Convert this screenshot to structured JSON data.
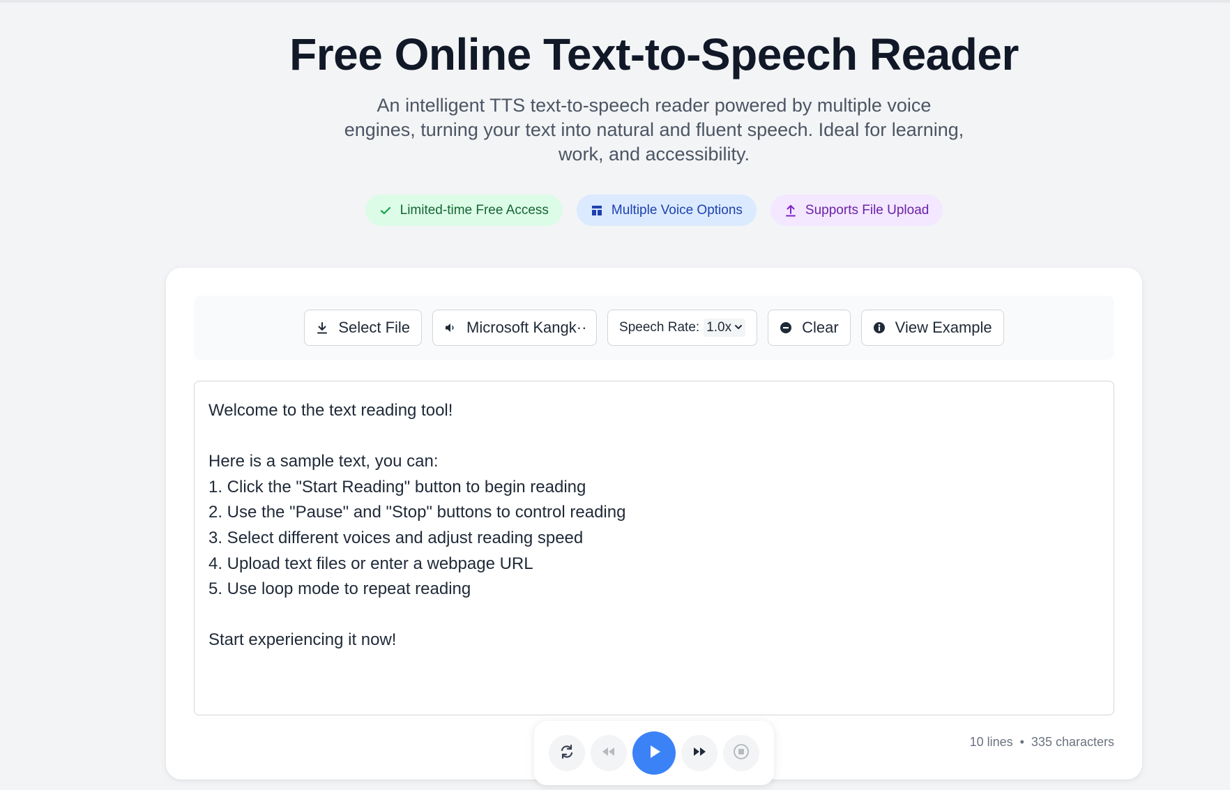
{
  "hero": {
    "title": "Free Online Text-to-Speech Reader",
    "subtitle": "An intelligent TTS text-to-speech reader powered by multiple voice engines, turning your text into natural and fluent speech. Ideal for learning, work, and accessibility."
  },
  "badges": [
    {
      "label": "Limited-time Free Access",
      "icon": "check-icon",
      "color": "#166534"
    },
    {
      "label": "Multiple Voice Options",
      "icon": "layout-icon",
      "color": "#1e40af"
    },
    {
      "label": "Supports File Upload",
      "icon": "upload-icon",
      "color": "#6b21a8"
    }
  ],
  "toolbar": {
    "select_file": "Select File",
    "voice": "Microsoft Kangk···",
    "rate_label": "Speech Rate:",
    "rate_value": "1.0x",
    "clear": "Clear",
    "view_example": "View Example"
  },
  "editor": {
    "text": "Welcome to the text reading tool!\n\nHere is a sample text, you can:\n1. Click the \"Start Reading\" button to begin reading\n2. Use the \"Pause\" and \"Stop\" buttons to control reading\n3. Select different voices and adjust reading speed\n4. Upload text files or enter a webpage URL\n5. Use loop mode to repeat reading\n\nStart experiencing it now!"
  },
  "stats": {
    "lines": "10 lines",
    "separator": "•",
    "characters": "335 characters"
  },
  "player": {
    "accent": "#3b82f6",
    "buttons": [
      "loop-icon",
      "rewind-icon",
      "play-icon",
      "fast-forward-icon",
      "stop-icon"
    ]
  }
}
